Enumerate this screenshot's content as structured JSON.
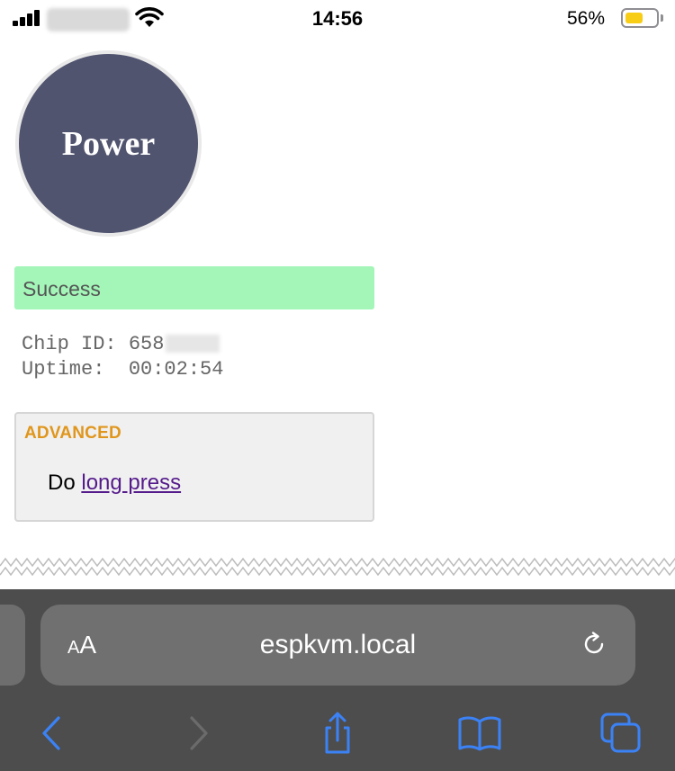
{
  "status_bar": {
    "time": "14:56",
    "battery_percent": "56%",
    "battery_level": 0.56,
    "battery_color": "#f8cd16"
  },
  "power_button": {
    "label": "Power",
    "color": "#51546f"
  },
  "status_message": {
    "text": "Success",
    "color": "#a3f6b8"
  },
  "info": {
    "chip_id_label": "Chip ID:",
    "chip_id_value": "658",
    "uptime_label": "Uptime:",
    "uptime_value": "00:02:54"
  },
  "advanced": {
    "title": "ADVANCED",
    "prefix": "Do",
    "link_text": "long press",
    "accent_color": "#e0961c"
  },
  "browser": {
    "text_size_label_large": "A",
    "text_size_label_small": "A",
    "url": "espkvm.local",
    "icons": [
      "reload-icon",
      "back-icon",
      "forward-icon",
      "share-icon",
      "bookmarks-icon",
      "tabs-icon"
    ],
    "accent_color": "#3b82f6"
  }
}
